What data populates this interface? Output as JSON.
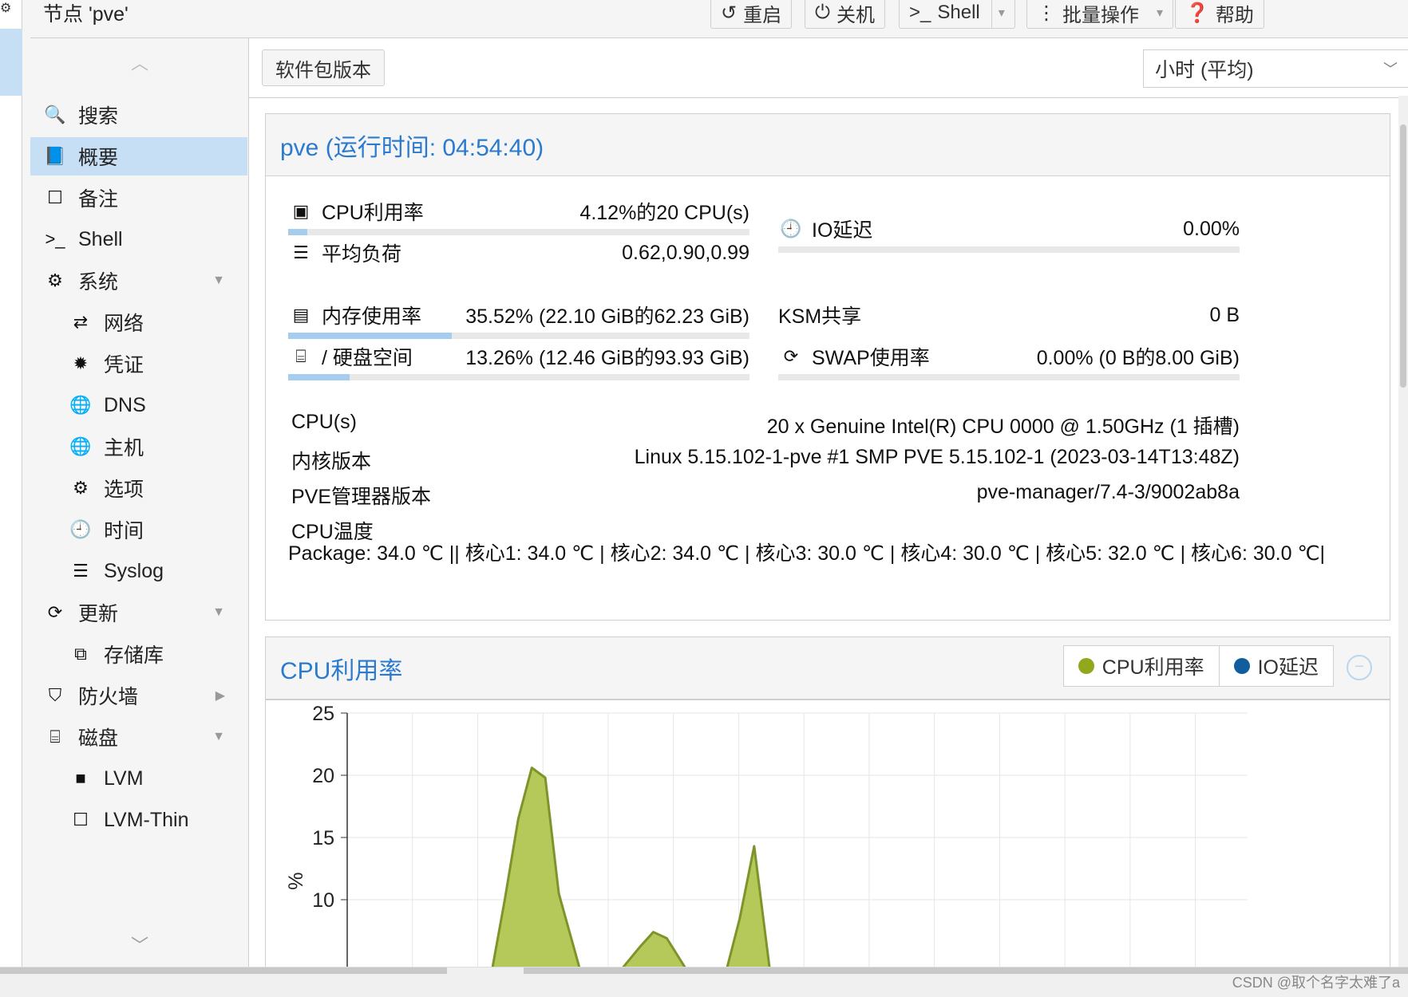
{
  "header": {
    "node_title": "节点 'pve'",
    "buttons": {
      "restart": "重启",
      "shutdown": "关机",
      "shell": "Shell",
      "bulk": "批量操作",
      "help": "帮助"
    }
  },
  "nav": {
    "items": [
      {
        "label": "搜索",
        "icon": "search-icon",
        "glyph": "🔍"
      },
      {
        "label": "概要",
        "icon": "book-icon",
        "glyph": "📘"
      },
      {
        "label": "备注",
        "icon": "note-icon",
        "glyph": "☐"
      },
      {
        "label": "Shell",
        "icon": "terminal-icon",
        "glyph": ">_"
      },
      {
        "label": "系统",
        "icon": "cogs-icon",
        "glyph": "⚙"
      },
      {
        "label": "网络",
        "icon": "exchange-icon",
        "glyph": "⇄"
      },
      {
        "label": "凭证",
        "icon": "certificate-icon",
        "glyph": "✹"
      },
      {
        "label": "DNS",
        "icon": "globe-icon",
        "glyph": "🌐"
      },
      {
        "label": "主机",
        "icon": "globe-icon",
        "glyph": "🌐"
      },
      {
        "label": "选项",
        "icon": "gear-icon",
        "glyph": "⚙"
      },
      {
        "label": "时间",
        "icon": "clock-icon",
        "glyph": "🕘"
      },
      {
        "label": "Syslog",
        "icon": "list-icon",
        "glyph": "☰"
      },
      {
        "label": "更新",
        "icon": "refresh-icon",
        "glyph": "⟳"
      },
      {
        "label": "存储库",
        "icon": "files-icon",
        "glyph": "⧉"
      },
      {
        "label": "防火墙",
        "icon": "shield-icon",
        "glyph": "⛉"
      },
      {
        "label": "磁盘",
        "icon": "hdd-icon",
        "glyph": "⌸"
      },
      {
        "label": "LVM",
        "icon": "square-icon",
        "glyph": "■"
      },
      {
        "label": "LVM-Thin",
        "icon": "square-outline-icon",
        "glyph": "☐"
      }
    ]
  },
  "toolbar": {
    "package_versions": "软件包版本",
    "timeframe": "小时 (平均)"
  },
  "status": {
    "title": "pve (运行时间: 04:54:40)",
    "cpu_label": "CPU利用率",
    "cpu_value": "4.12%的20 CPU(s)",
    "cpu_fraction": 0.0412,
    "load_label": "平均负荷",
    "load_value": "0.62,0.90,0.99",
    "io_label": "IO延迟",
    "io_value": "0.00%",
    "io_fraction": 0,
    "mem_label": "内存使用率",
    "mem_value": "35.52% (22.10 GiB的62.23 GiB)",
    "mem_fraction": 0.3552,
    "ksm_label": "KSM共享",
    "ksm_value": "0 B",
    "disk_label": "/ 硬盘空间",
    "disk_value": "13.26% (12.46 GiB的93.93 GiB)",
    "disk_fraction": 0.1326,
    "swap_label": "SWAP使用率",
    "swap_value": "0.00% (0 B的8.00 GiB)",
    "swap_fraction": 0,
    "cpus_label": "CPU(s)",
    "cpus_value": "20 x Genuine Intel(R) CPU 0000 @ 1.50GHz (1 插槽)",
    "kernel_label": "内核版本",
    "kernel_value": "Linux 5.15.102-1-pve #1 SMP PVE 5.15.102-1 (2023-03-14T13:48Z)",
    "pve_label": "PVE管理器版本",
    "pve_value": "pve-manager/7.4-3/9002ab8a",
    "temp_label": "CPU温度",
    "temp_value": "Package: 34.0 ℃ || 核心1: 34.0 ℃ | 核心2: 34.0 ℃ | 核心3: 30.0 ℃ | 核心4: 30.0 ℃ | 核心5: 32.0 ℃ | 核心6: 30.0 ℃|"
  },
  "cpu_chart": {
    "title": "CPU利用率",
    "legend_cpu": "CPU利用率",
    "legend_io": "IO延迟",
    "collapse_glyph": "−",
    "ylabel": "%"
  },
  "chart_data": {
    "type": "area",
    "title": "CPU利用率",
    "ylabel": "%",
    "yticks": [
      "25",
      "20",
      "15",
      "10"
    ],
    "ylim": [
      5,
      25
    ],
    "xlim": [
      0,
      100
    ],
    "series": [
      {
        "name": "CPU利用率",
        "color": "#b5c95a",
        "x": [
          0,
          16,
          17.5,
          19,
          20.5,
          22,
          23.5,
          26,
          30,
          32.5,
          34,
          35.5,
          38,
          42,
          43.6,
          45.2,
          47,
          100
        ],
        "y": [
          4,
          4,
          10,
          16.5,
          20.6,
          19.8,
          10.5,
          4,
          4,
          6.2,
          7.4,
          6.9,
          4,
          4,
          8.5,
          14.3,
          4,
          4
        ]
      },
      {
        "name": "IO延迟",
        "color": "#115d9e",
        "x": [
          0,
          100
        ],
        "y": [
          0,
          0
        ]
      }
    ]
  },
  "watermark": "CSDN @取个名字太难了a",
  "colors": {
    "accent": "#2a7bd0",
    "selected": "#c7dff5",
    "bar_fill": "#a6ccee",
    "cpu_series": "#b5c95a",
    "io_series": "#115d9e"
  }
}
